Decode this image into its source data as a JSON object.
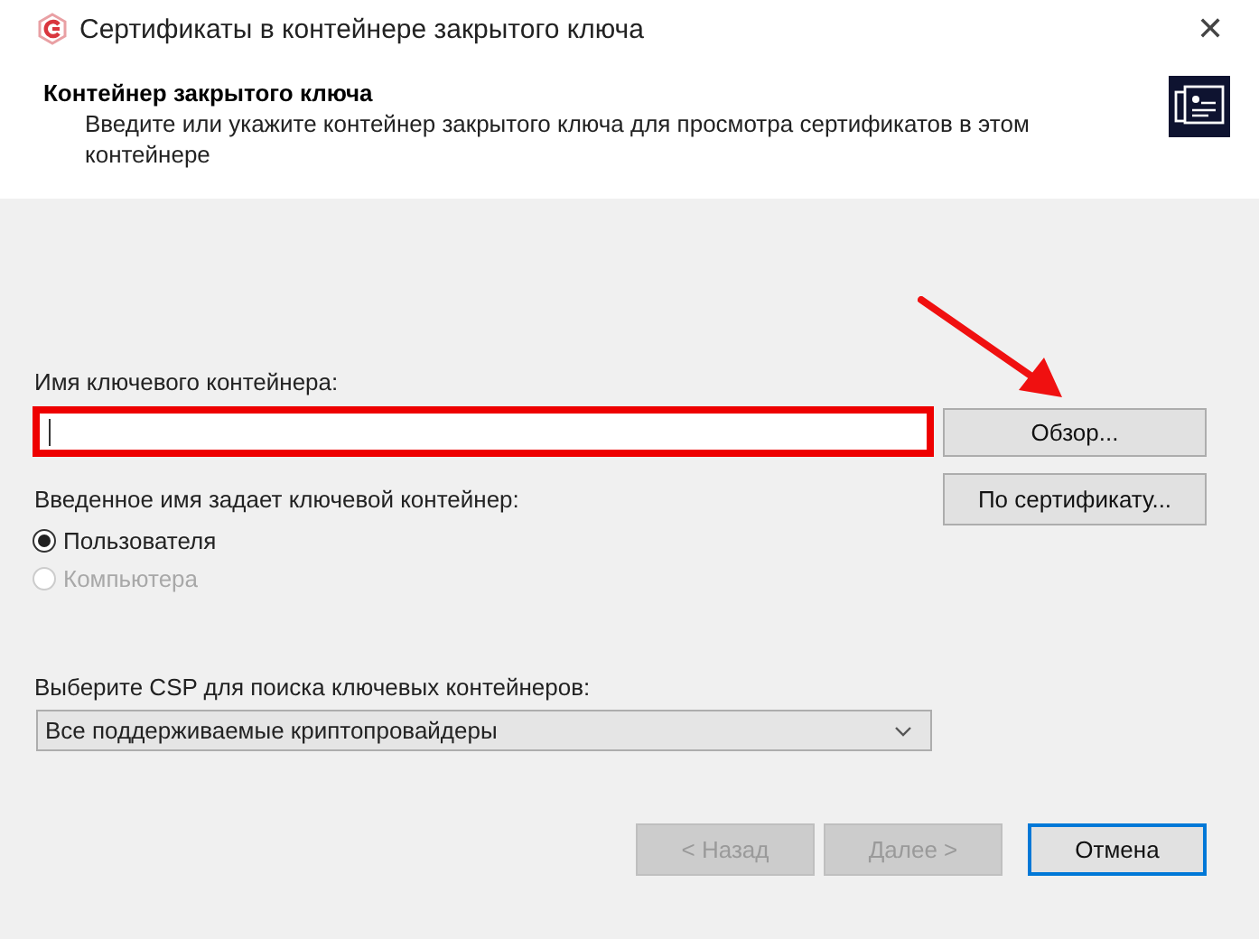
{
  "window": {
    "title": "Сертификаты в контейнере закрытого ключа",
    "close": "✕"
  },
  "header": {
    "title": "Контейнер закрытого ключа",
    "description": "Введите или укажите контейнер закрытого ключа для просмотра сертификатов в этом контейнере"
  },
  "container_name": {
    "label": "Имя ключевого контейнера:",
    "highlighted": true,
    "annotation_arrow": true
  },
  "browse_button": "Обзор...",
  "by_certificate_button": "По сертификату...",
  "scope": {
    "label": "Введенное имя задает ключевой контейнер:",
    "options": [
      {
        "label": "Пользователя",
        "selected": true,
        "disabled": false
      },
      {
        "label": "Компьютера",
        "selected": false,
        "disabled": true
      }
    ]
  },
  "csp": {
    "label": "Выберите CSP для поиска ключевых контейнеров:",
    "value": "Все поддерживаемые криптопровайдеры"
  },
  "buttons": [
    {
      "label": "< Назад",
      "disabled": true,
      "default": false
    },
    {
      "label": "Далее >",
      "disabled": true,
      "default": false
    },
    {
      "label": "Отмена",
      "disabled": false,
      "default": true
    }
  ]
}
